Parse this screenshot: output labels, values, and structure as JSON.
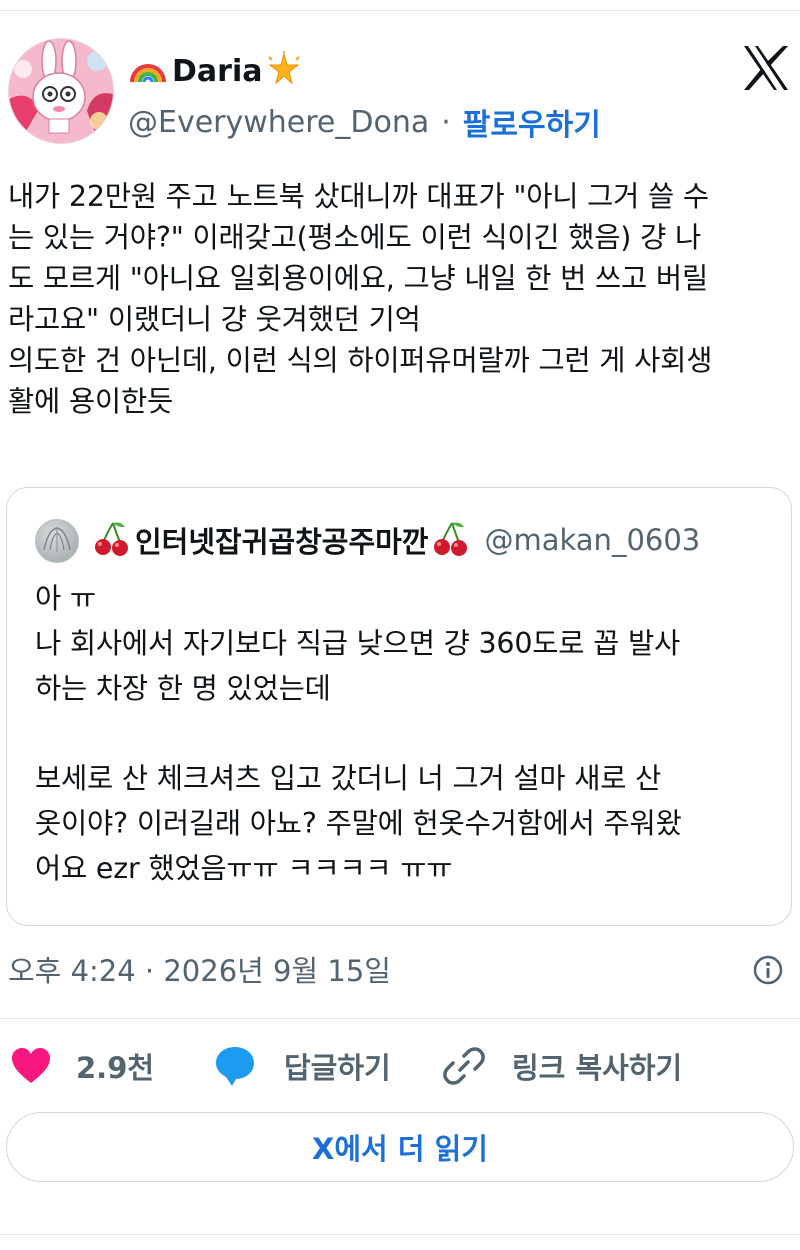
{
  "author": {
    "display_name": "Daria",
    "handle": "@Everywhere_Dona",
    "follow_label": "팔로우하기",
    "separator": "·",
    "name_prefix_icon": "rainbow-icon",
    "name_suffix_icon": "sparkle-star-icon"
  },
  "tweet": {
    "text": "내가 22만원 주고 노트북 샀대니까 대표가 \"아니 그거 쓸 수\n는 있는 거야?\" 이래갖고(평소에도 이런 식이긴 했음) 걍 나\n도 모르게 \"아니요 일회용이에요, 그냥 내일 한 번 쓰고 버릴\n라고요\" 이랬더니 걍 웃겨했던 기억\n의도한 건 아닌데, 이런 식의 하이퍼유머랄까 그런 게 사회생\n활에 용이한듯"
  },
  "quote": {
    "display_name": "인터넷잡귀곱창공주마깐",
    "handle": "@makan_0603",
    "name_icon": "cherries-icon",
    "text": "아 ㅠ\n나 회사에서 자기보다 직급 낮으면 걍 360도로 꼽 발사\n하는 차장 한 명 있었는데\n\n보세로 산 체크셔츠 입고 갔더니 너 그거 설마 새로 산\n옷이야? 이러길래 아뇨? 주말에 헌옷수거함에서 주워왔\n어요 ezr 했었음ㅠㅠ ㅋㅋㅋㅋ ㅠㅠ"
  },
  "meta": {
    "timestamp": "오후 4:24 · 2026년 9월 15일",
    "info_icon": "info-icon"
  },
  "actions": {
    "like_count": "2.9천",
    "reply_label": "답글하기",
    "copy_link_label": "링크 복사하기",
    "read_more_label": "X에서 더 읽기"
  },
  "colors": {
    "text": "#0f1419",
    "secondary": "#536471",
    "link_blue": "#1d6fd8",
    "like_pink": "#f91880",
    "reply_blue": "#1d9bf0",
    "border": "#cfd9de"
  }
}
